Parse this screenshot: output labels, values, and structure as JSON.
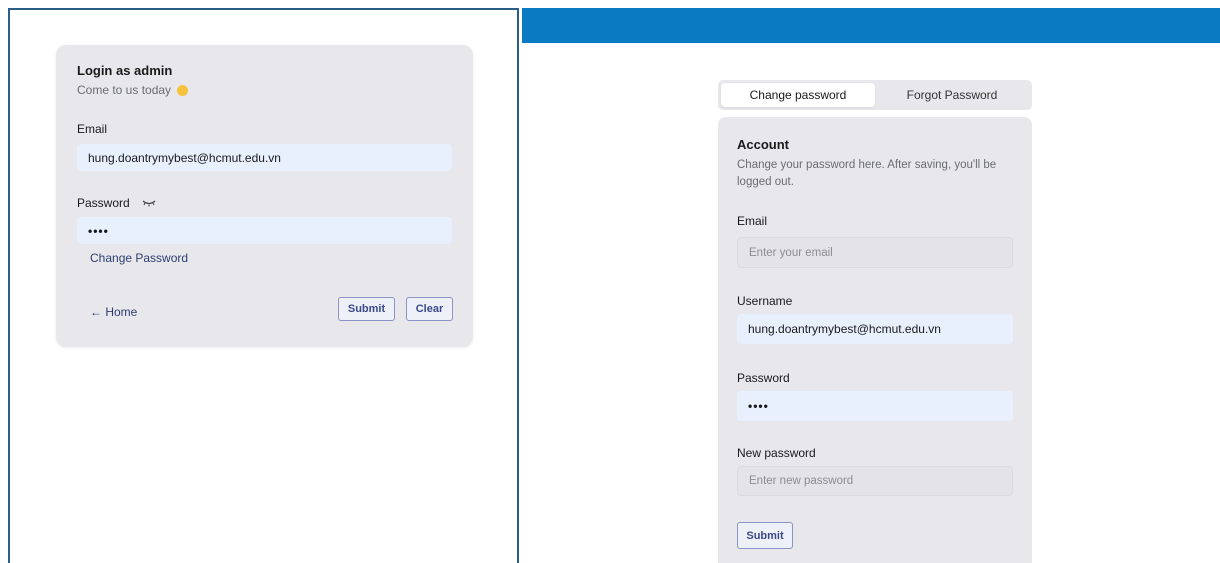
{
  "login": {
    "title": "Login as admin",
    "subtitle": "Come to us today",
    "email_label": "Email",
    "email_value": "hung.doantrymybest@hcmut.edu.vn",
    "password_label": "Password",
    "password_value": "••••",
    "change_password_link": "Change Password",
    "home_link": "← Home",
    "submit_label": "Submit",
    "clear_label": "Clear"
  },
  "tabs": [
    {
      "label": "Change password",
      "active": true
    },
    {
      "label": "Forgot Password",
      "active": false
    }
  ],
  "account": {
    "title": "Account",
    "description": "Change your password here. After saving, you'll be logged out.",
    "email_label": "Email",
    "email_placeholder": "Enter your email",
    "username_label": "Username",
    "username_value": "hung.doantrymybest@hcmut.edu.vn",
    "password_label": "Password",
    "password_value": "••••",
    "new_password_label": "New password",
    "new_password_placeholder": "Enter new password",
    "submit_label": "Submit"
  },
  "colors": {
    "top_bar": "#0a7bc2",
    "card_bg": "#e8e8ec",
    "autofill_bg": "#e8f0fe",
    "panel_border": "#2a5d8a",
    "sun_icon": "#f5c33b"
  },
  "icons": {
    "subtitle_icon": "sun-icon",
    "password_toggle": "eye-closed-icon"
  }
}
